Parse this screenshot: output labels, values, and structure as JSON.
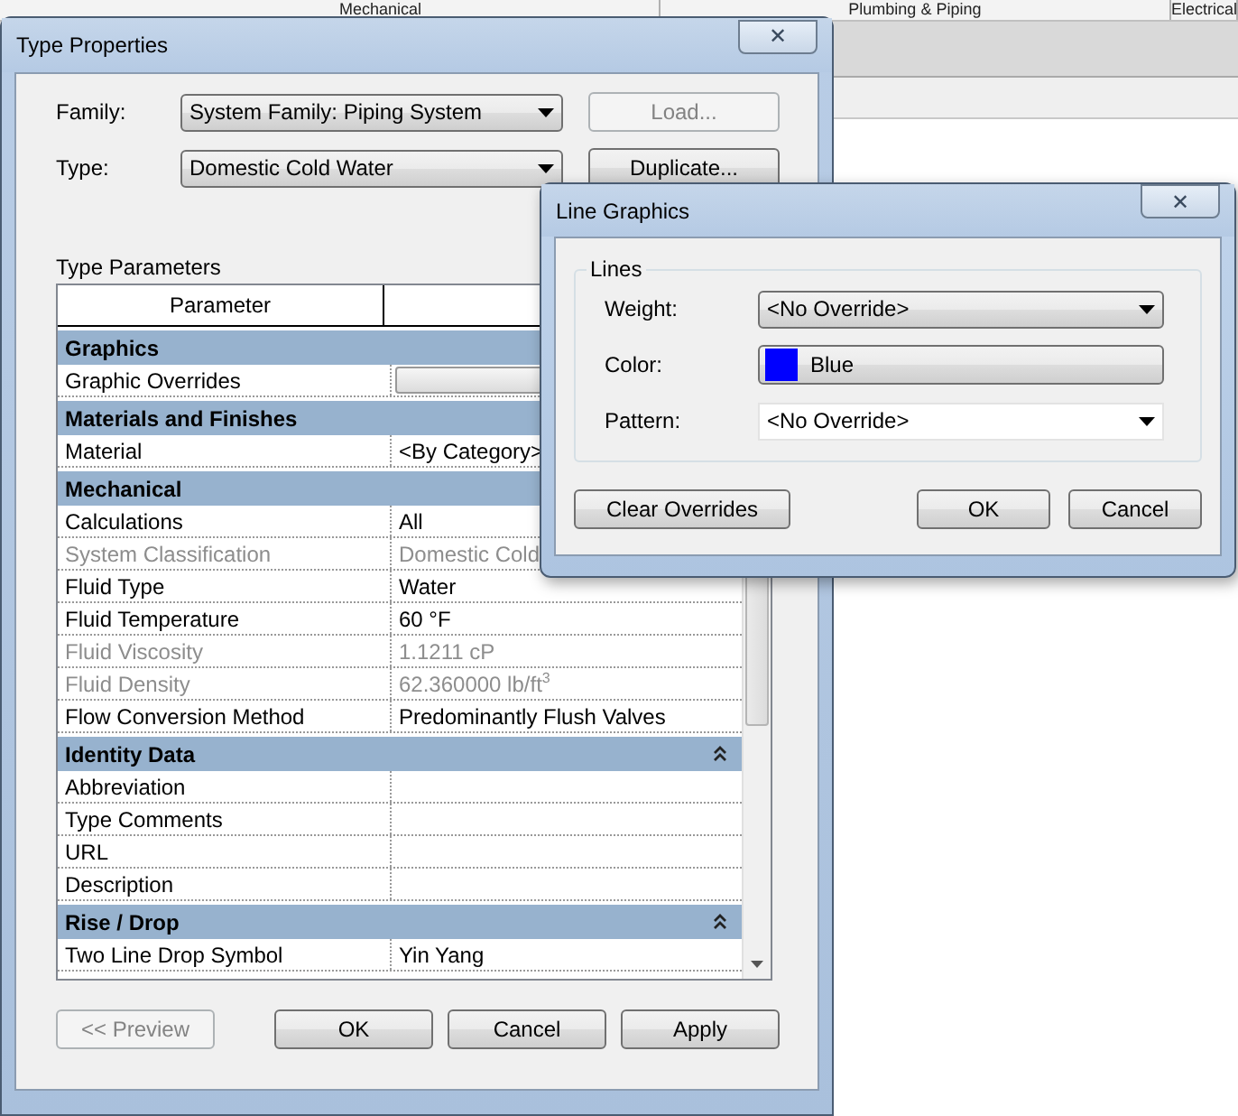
{
  "ribbon": {
    "tabs": [
      "Mechanical",
      "Plumbing & Piping",
      "Electrical"
    ]
  },
  "type_properties": {
    "title": "Type Properties",
    "close": "✕",
    "family": {
      "label": "Family:",
      "value": "System Family: Piping System"
    },
    "type": {
      "label": "Type:",
      "value": "Domestic Cold Water"
    },
    "load_button": {
      "label": "Load...",
      "disabled": true
    },
    "duplicate_button": {
      "label": "Duplicate...",
      "disabled": false
    },
    "section_label": "Type Parameters",
    "columns": [
      "Parameter"
    ],
    "groups": [
      {
        "name": "Graphics",
        "rows": [
          {
            "name": "Graphic Overrides",
            "kind": "button",
            "value": "",
            "disabled": false
          }
        ]
      },
      {
        "name": "Materials and Finishes",
        "rows": [
          {
            "name": "Material",
            "kind": "text",
            "value": "<By Category>",
            "disabled": false
          }
        ]
      },
      {
        "name": "Mechanical",
        "rows": [
          {
            "name": "Calculations",
            "kind": "text",
            "value": "All",
            "disabled": false
          },
          {
            "name": "System Classification",
            "kind": "text",
            "value": "Domestic Cold",
            "disabled": true
          },
          {
            "name": "Fluid Type",
            "kind": "text",
            "value": "Water",
            "disabled": false
          },
          {
            "name": "Fluid Temperature",
            "kind": "text",
            "value": "60 °F",
            "disabled": false
          },
          {
            "name": "Fluid Viscosity",
            "kind": "text",
            "value": "1.1211 cP",
            "disabled": true
          },
          {
            "name": "Fluid Density",
            "kind": "text",
            "value": "62.360000 lb/ft$^{3}$",
            "disabled": true
          },
          {
            "name": "Flow Conversion Method",
            "kind": "text",
            "value": "Predominantly Flush Valves",
            "disabled": false
          }
        ]
      },
      {
        "name": "Identity Data",
        "expanded": true,
        "rows": [
          {
            "name": "Abbreviation",
            "kind": "text",
            "value": "",
            "disabled": false
          },
          {
            "name": "Type Comments",
            "kind": "text",
            "value": "",
            "disabled": false
          },
          {
            "name": "URL",
            "kind": "text",
            "value": "",
            "disabled": false
          },
          {
            "name": "Description",
            "kind": "text",
            "value": "",
            "disabled": false
          }
        ]
      },
      {
        "name": "Rise / Drop",
        "expanded": true,
        "rows": [
          {
            "name": "Two Line Drop Symbol",
            "kind": "text",
            "value": "Yin Yang",
            "disabled": false
          }
        ]
      }
    ],
    "buttons": [
      {
        "label": "<< Preview",
        "disabled": true
      },
      {
        "label": "OK",
        "disabled": false
      },
      {
        "label": "Cancel",
        "disabled": false
      },
      {
        "label": "Apply",
        "disabled": false
      }
    ]
  },
  "line_graphics": {
    "title": "Line Graphics",
    "close": "✕",
    "group_label": "Lines",
    "fields": [
      {
        "label": "Weight:",
        "kind": "dropdown",
        "value": "<No Override>"
      },
      {
        "label": "Color:",
        "kind": "color",
        "value": "Blue",
        "color": "#0000ff"
      },
      {
        "label": "Pattern:",
        "kind": "combo",
        "value": "<No Override>"
      }
    ],
    "buttons": [
      {
        "label": "Clear Overrides"
      },
      {
        "label": "OK"
      },
      {
        "label": "Cancel"
      }
    ]
  }
}
